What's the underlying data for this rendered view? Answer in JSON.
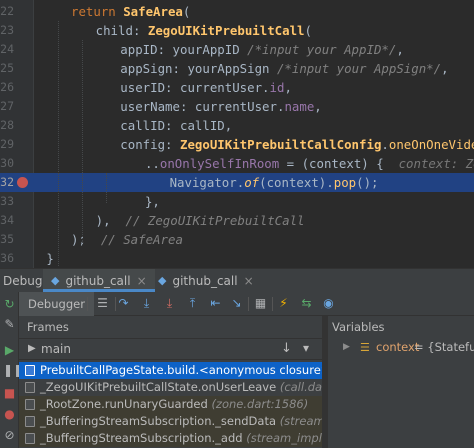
{
  "editor": {
    "lines": [
      {
        "num": "22",
        "indent": 0,
        "parts": [
          [
            "kw",
            "return "
          ],
          [
            "cls",
            "SafeArea"
          ],
          [
            "",
            "("
          ]
        ]
      },
      {
        "num": "23",
        "indent": 1,
        "parts": [
          [
            "named",
            "child: "
          ],
          [
            "cls",
            "ZegoUIKitPrebuiltCall"
          ],
          [
            "",
            "("
          ]
        ]
      },
      {
        "num": "24",
        "indent": 2,
        "parts": [
          [
            "named",
            "appID: "
          ],
          [
            "",
            "yourAppID "
          ],
          [
            "cmt",
            "/*input your AppID*/"
          ],
          [
            "",
            ","
          ]
        ]
      },
      {
        "num": "25",
        "indent": 2,
        "parts": [
          [
            "named",
            "appSign: "
          ],
          [
            "",
            "yourAppSign "
          ],
          [
            "cmt",
            "/*input your AppSign*/"
          ],
          [
            "",
            ","
          ]
        ]
      },
      {
        "num": "26",
        "indent": 2,
        "parts": [
          [
            "named",
            "userID: "
          ],
          [
            "",
            "currentUser."
          ],
          [
            "fld",
            "id"
          ],
          [
            "",
            ","
          ]
        ]
      },
      {
        "num": "27",
        "indent": 2,
        "parts": [
          [
            "named",
            "userName: "
          ],
          [
            "",
            "currentUser."
          ],
          [
            "fld",
            "name"
          ],
          [
            "",
            ","
          ]
        ]
      },
      {
        "num": "28",
        "indent": 2,
        "parts": [
          [
            "named",
            "callID: "
          ],
          [
            "",
            "callID,"
          ]
        ]
      },
      {
        "num": "29",
        "indent": 2,
        "parts": [
          [
            "named",
            "config: "
          ],
          [
            "cls",
            "ZegoUIKitPrebuiltCallConfig"
          ],
          [
            "",
            "."
          ],
          [
            "fn",
            "oneOnOneVideoCall"
          ],
          [
            "",
            "()"
          ]
        ]
      },
      {
        "num": "30",
        "indent": 3,
        "parts": [
          [
            "",
            ".."
          ],
          [
            "fld",
            "onOnlySelfInRoom"
          ],
          [
            "",
            " = (context) {  "
          ],
          [
            "hint",
            "context: ZegoUIKitPrebuil"
          ]
        ]
      },
      {
        "num": "32",
        "indent": 4,
        "parts": [
          [
            "",
            "Navigator."
          ],
          [
            "fn it",
            "of"
          ],
          [
            "",
            "(context)."
          ],
          [
            "fn",
            "pop"
          ],
          [
            "",
            "();"
          ]
        ]
      },
      {
        "num": "33",
        "indent": 3,
        "parts": [
          [
            "",
            "},"
          ]
        ]
      },
      {
        "num": "34",
        "indent": 1,
        "parts": [
          [
            "",
            "),  "
          ],
          [
            "cmt",
            "// ZegoUIKitPrebuiltCall"
          ]
        ]
      },
      {
        "num": "35",
        "indent": 0,
        "parts": [
          [
            "",
            ");  "
          ],
          [
            "cmt",
            "// SafeArea"
          ]
        ]
      },
      {
        "num": "36",
        "indent": -1,
        "parts": [
          [
            "",
            "}"
          ]
        ]
      },
      {
        "num": "37",
        "indent": -2,
        "parts": [
          [
            "",
            "}"
          ]
        ]
      }
    ],
    "highlight_line": "32",
    "breakpoint_line": "32"
  },
  "debug": {
    "label": "Debug:",
    "tabs": [
      {
        "label": "github_call",
        "active": true
      },
      {
        "label": "github_call",
        "active": false
      }
    ],
    "toolbar_tab": "Debugger",
    "toolbar_icons": [
      "console-icon",
      "step-over-icon",
      "step-into-icon",
      "force-step-into-icon",
      "step-out-icon",
      "drop-frame-icon",
      "run-to-cursor-icon",
      "evaluate-icon",
      "table-icon",
      "trace-icon",
      "flash-icon",
      "mute-breakpoints-icon"
    ]
  },
  "frames": {
    "title": "Frames",
    "thread": "main",
    "items": [
      {
        "text": "PrebuiltCallPageState.build.<anonymous closure>",
        "loc": "(prebu",
        "selected": true,
        "lib": false
      },
      {
        "text": "_ZegoUIKitPrebuiltCallState.onUserLeave",
        "loc": "(call.dart:179",
        "selected": false,
        "lib": false
      },
      {
        "text": "_RootZone.runUnaryGuarded",
        "loc": "(zone.dart:1586)",
        "selected": false,
        "lib": true
      },
      {
        "text": "_BufferingStreamSubscription._sendData",
        "loc": "(stream_impl.",
        "selected": false,
        "lib": true
      },
      {
        "text": "_BufferingStreamSubscription._add",
        "loc": "(stream_impl.d",
        "selected": false,
        "lib": true
      }
    ]
  },
  "variables": {
    "title": "Variables",
    "items": [
      {
        "name": "context",
        "value": "{StatefulEl"
      }
    ]
  },
  "colors": {
    "editor_bg": "#2b2b2b",
    "highlight": "#214283",
    "breakpoint": "#c75450",
    "selection": "#0d62c7",
    "keyword": "#cc7832",
    "class": "#ffc66d",
    "field": "#9876aa",
    "comment": "#808080"
  }
}
